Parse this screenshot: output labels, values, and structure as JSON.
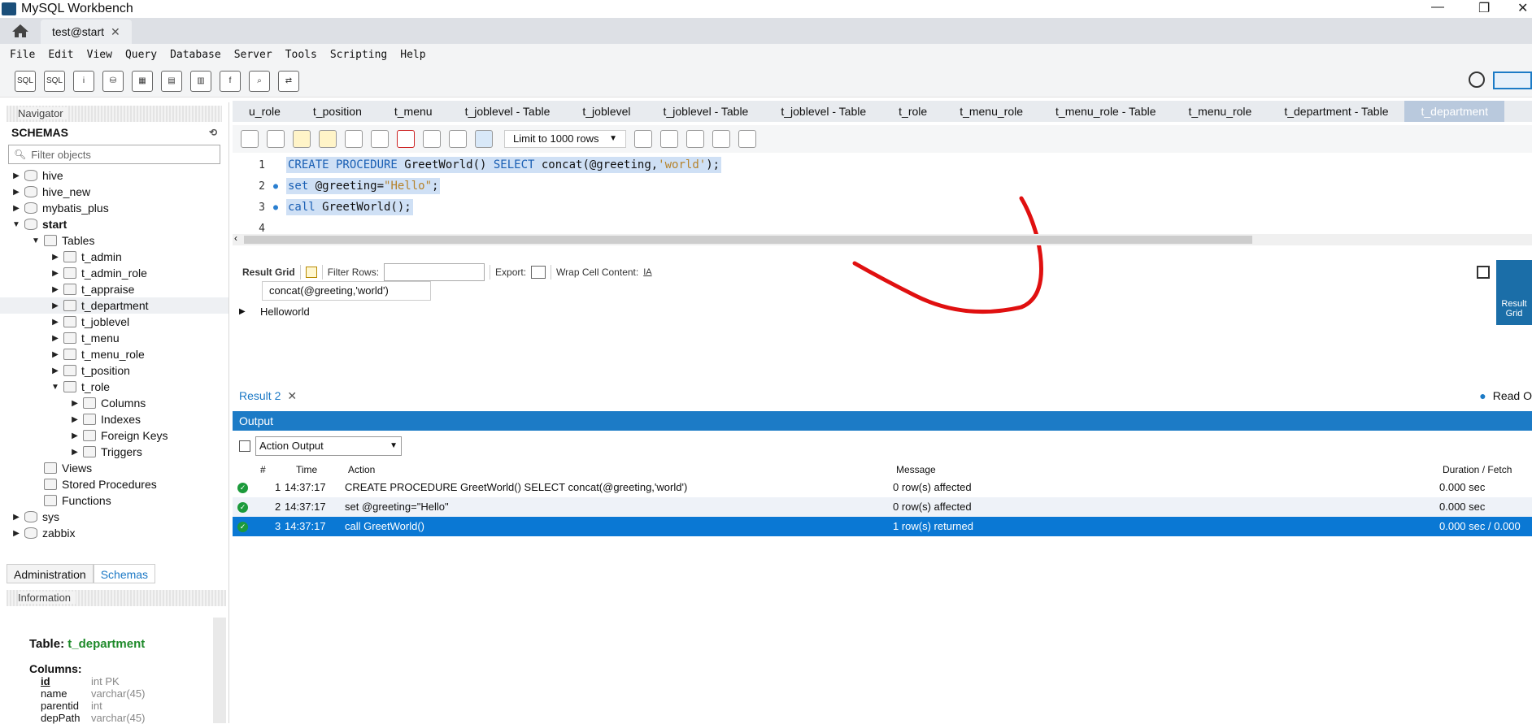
{
  "window": {
    "title": "MySQL Workbench"
  },
  "tabs": {
    "connection": "test@start"
  },
  "menu": [
    "File",
    "Edit",
    "View",
    "Query",
    "Database",
    "Server",
    "Tools",
    "Scripting",
    "Help"
  ],
  "sidebar": {
    "navigator_title": "Navigator",
    "schemas_title": "SCHEMAS",
    "filter_placeholder": "Filter objects",
    "tree": [
      {
        "label": "hive",
        "depth": 0,
        "arrow": "▶",
        "kind": "db"
      },
      {
        "label": "hive_new",
        "depth": 0,
        "arrow": "▶",
        "kind": "db"
      },
      {
        "label": "mybatis_plus",
        "depth": 0,
        "arrow": "▶",
        "kind": "db"
      },
      {
        "label": "start",
        "depth": 0,
        "arrow": "▼",
        "kind": "db",
        "bold": true
      },
      {
        "label": "Tables",
        "depth": 1,
        "arrow": "▼",
        "kind": "folder"
      },
      {
        "label": "t_admin",
        "depth": 2,
        "arrow": "▶",
        "kind": "table"
      },
      {
        "label": "t_admin_role",
        "depth": 2,
        "arrow": "▶",
        "kind": "table"
      },
      {
        "label": "t_appraise",
        "depth": 2,
        "arrow": "▶",
        "kind": "table"
      },
      {
        "label": "t_department",
        "depth": 2,
        "arrow": "▶",
        "kind": "table",
        "selected": true
      },
      {
        "label": "t_joblevel",
        "depth": 2,
        "arrow": "▶",
        "kind": "table"
      },
      {
        "label": "t_menu",
        "depth": 2,
        "arrow": "▶",
        "kind": "table"
      },
      {
        "label": "t_menu_role",
        "depth": 2,
        "arrow": "▶",
        "kind": "table"
      },
      {
        "label": "t_position",
        "depth": 2,
        "arrow": "▶",
        "kind": "table"
      },
      {
        "label": "t_role",
        "depth": 2,
        "arrow": "▼",
        "kind": "table"
      },
      {
        "label": "Columns",
        "depth": 3,
        "arrow": "▶",
        "kind": "folder"
      },
      {
        "label": "Indexes",
        "depth": 3,
        "arrow": "▶",
        "kind": "folder"
      },
      {
        "label": "Foreign Keys",
        "depth": 3,
        "arrow": "▶",
        "kind": "folder"
      },
      {
        "label": "Triggers",
        "depth": 3,
        "arrow": "▶",
        "kind": "folder"
      },
      {
        "label": "Views",
        "depth": 1,
        "arrow": "",
        "kind": "folder"
      },
      {
        "label": "Stored Procedures",
        "depth": 1,
        "arrow": "",
        "kind": "folder"
      },
      {
        "label": "Functions",
        "depth": 1,
        "arrow": "",
        "kind": "folder"
      },
      {
        "label": "sys",
        "depth": 0,
        "arrow": "▶",
        "kind": "db"
      },
      {
        "label": "zabbix",
        "depth": 0,
        "arrow": "▶",
        "kind": "db"
      }
    ],
    "bottom_tabs": [
      "Administration",
      "Schemas"
    ],
    "info_title": "Information",
    "info": {
      "table_label": "Table:",
      "table_name": "t_department",
      "columns_label": "Columns:",
      "columns": [
        {
          "name": "id",
          "type": "int PK"
        },
        {
          "name": "name",
          "type": "varchar(45)"
        },
        {
          "name": "parentid",
          "type": "int"
        },
        {
          "name": "depPath",
          "type": "varchar(45)"
        }
      ]
    }
  },
  "query_tabs": [
    "u_role",
    "t_position",
    "t_menu",
    "t_joblevel - Table",
    "t_joblevel",
    "t_joblevel - Table",
    "t_joblevel - Table",
    "t_role",
    "t_menu_role",
    "t_menu_role - Table",
    "t_menu_role",
    "t_department - Table",
    "t_department"
  ],
  "query_toolbar": {
    "limit": "Limit to 1000 rows"
  },
  "editor": {
    "lines": [
      {
        "n": "1",
        "dot": false
      },
      {
        "n": "2",
        "dot": true
      },
      {
        "n": "3",
        "dot": true
      },
      {
        "n": "4",
        "dot": false
      }
    ],
    "code1_kw1": "CREATE PROCEDURE",
    "code1_a": " GreetWorld() ",
    "code1_kw2": "SELECT",
    "code1_b": " concat(@greeting,",
    "code1_str": "'world'",
    "code1_c": ");",
    "code2_kw": "set",
    "code2_a": " @greeting=",
    "code2_str": "\"Hello\"",
    "code2_b": ";",
    "code3_kw": "call",
    "code3_a": " GreetWorld();"
  },
  "result_bar": {
    "result_grid": "Result Grid",
    "filter_rows": "Filter Rows:",
    "export": "Export:",
    "wrap": "Wrap Cell Content:",
    "side_button": "Result Grid"
  },
  "result_grid": {
    "column": "concat(@greeting,'world')",
    "value": "Helloworld"
  },
  "result_tab": "Result 2",
  "read_only": "Read O",
  "output": {
    "title": "Output",
    "select": "Action Output",
    "headers": {
      "num": "#",
      "time": "Time",
      "action": "Action",
      "message": "Message",
      "duration": "Duration / Fetch"
    },
    "rows": [
      {
        "num": "1",
        "time": "14:37:17",
        "action": "CREATE PROCEDURE GreetWorld() SELECT concat(@greeting,'world')",
        "message": "0 row(s) affected",
        "duration": "0.000 sec"
      },
      {
        "num": "2",
        "time": "14:37:17",
        "action": "set @greeting=\"Hello\"",
        "message": "0 row(s) affected",
        "duration": "0.000 sec"
      },
      {
        "num": "3",
        "time": "14:37:17",
        "action": "call GreetWorld()",
        "message": "1 row(s) returned",
        "duration": "0.000 sec / 0.000"
      }
    ]
  }
}
